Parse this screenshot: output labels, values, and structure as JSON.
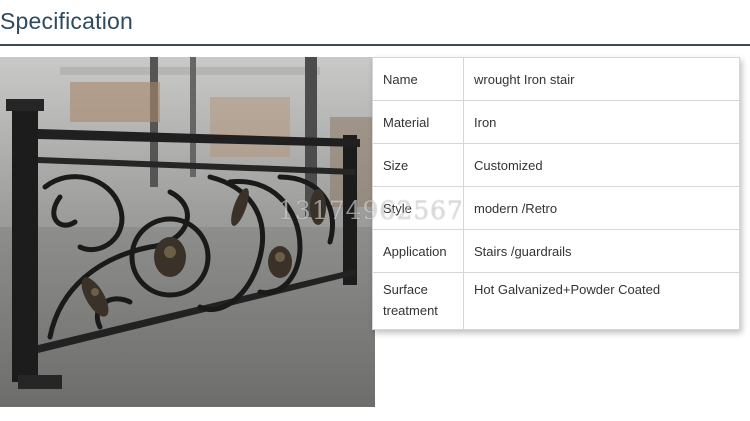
{
  "header": {
    "title": "Specification"
  },
  "photo": {
    "subject": "wrought iron stair railing",
    "watermark": "13174962567"
  },
  "spec_table": {
    "rows": [
      {
        "key": "Name",
        "value": "wrought Iron stair"
      },
      {
        "key": "Material",
        "value": "Iron"
      },
      {
        "key": "Size",
        "value": "Customized"
      },
      {
        "key": "Style",
        "value": "modern /Retro"
      },
      {
        "key": "Application",
        "value": "Stairs /guardrails"
      },
      {
        "key": "Surface treatment",
        "value": "Hot Galvanized+Powder Coated"
      }
    ]
  }
}
